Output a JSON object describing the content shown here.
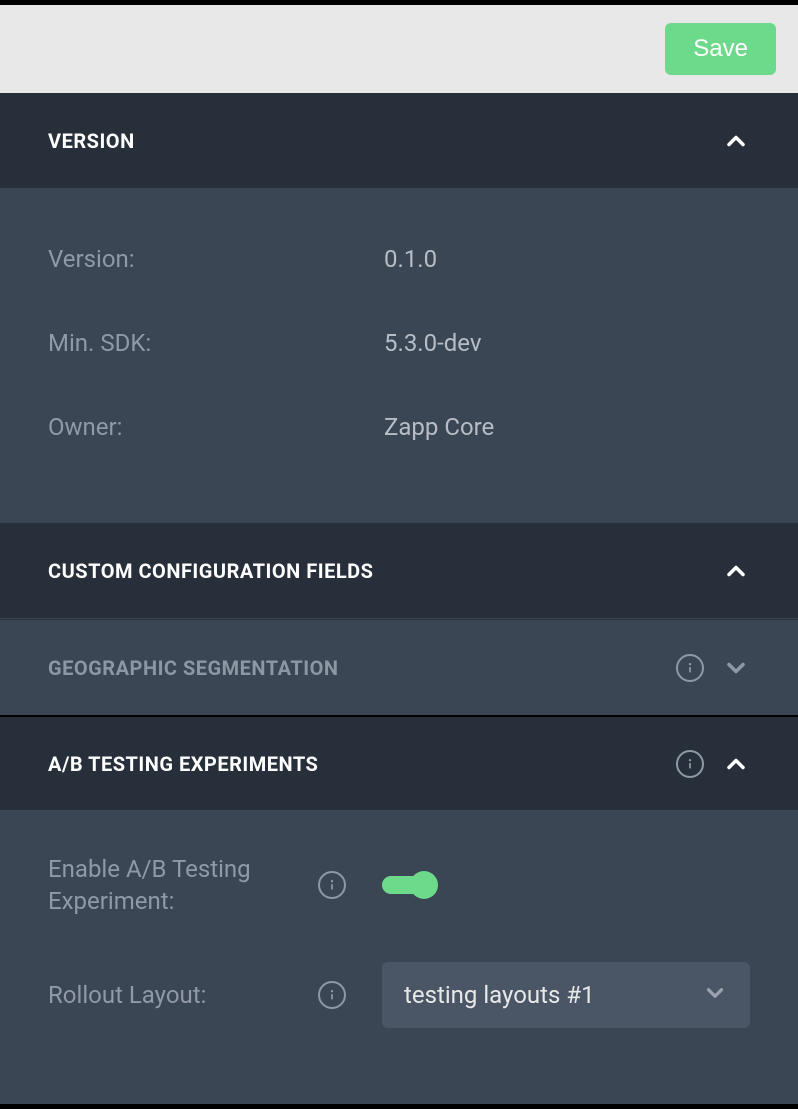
{
  "header": {
    "save_label": "Save"
  },
  "sections": {
    "version": {
      "title": "Version",
      "fields": {
        "version_label": "Version:",
        "version_value": "0.1.0",
        "minsdk_label": "Min. SDK:",
        "minsdk_value": "5.3.0-dev",
        "owner_label": "Owner:",
        "owner_value": "Zapp Core"
      }
    },
    "customConfig": {
      "title": "Custom Configuration Fields"
    },
    "geoSegmentation": {
      "title": "Geographic Segmentation"
    },
    "abTesting": {
      "title": "A/B Testing Experiments",
      "fields": {
        "enable_label": "Enable A/B Testing Experiment:",
        "enable_value": true,
        "rollout_label": "Rollout Layout:",
        "rollout_value": "testing layouts #1"
      }
    }
  }
}
